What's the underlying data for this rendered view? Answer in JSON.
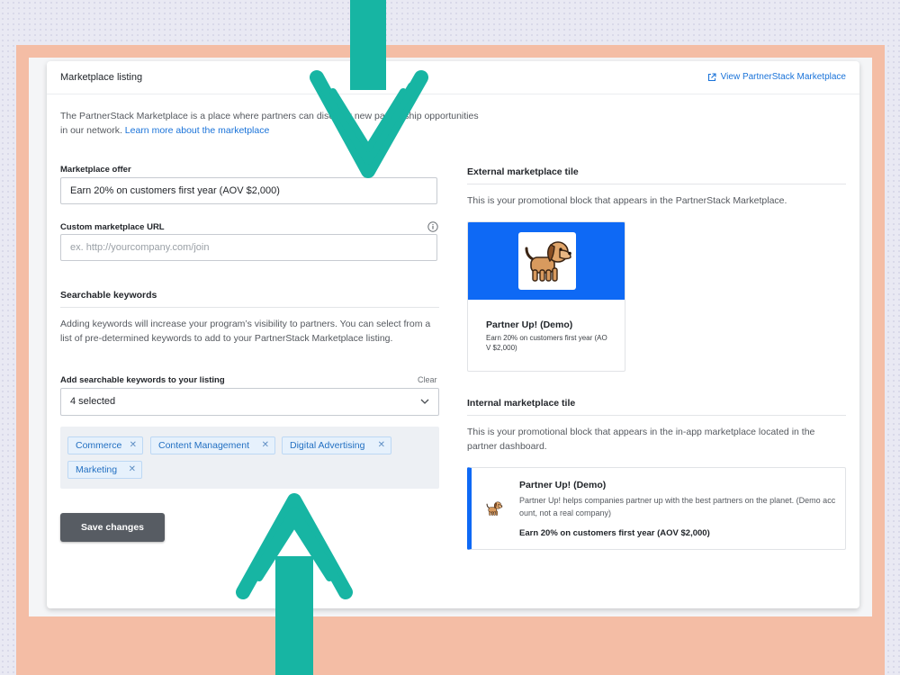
{
  "header": {
    "title": "Marketplace listing",
    "view_link": "View PartnerStack Marketplace"
  },
  "intro": {
    "text_before": "The PartnerStack Marketplace is a place where partners ",
    "text_hidden": "can discover new partnership opportunities",
    "text_line2": "in our network. ",
    "link": "Learn more about the marketplace"
  },
  "form": {
    "offer_label": "Marketplace offer",
    "offer_value": "Earn 20% on customers first year (AOV $2,000)",
    "url_label": "Custom marketplace URL",
    "url_placeholder": "ex. http://yourcompany.com/join"
  },
  "keywords": {
    "heading": "Searchable keywords",
    "description": "Adding keywords will increase your program’s visibility to partners. You can select from a list of pre-determined keywords to add to your PartnerStack Marketplace listing.",
    "add_label": "Add searchable keywords to your listing",
    "clear_label": "Clear",
    "selected_text": "4 selected",
    "chips": [
      "Commerce",
      "Content Management",
      "Digital Advertising",
      "Marketing"
    ]
  },
  "save_button": "Save changes",
  "external_tile": {
    "heading": "External marketplace tile",
    "description": "This is your promotional block that appears in the PartnerStack Marketplace.",
    "name": "Partner Up! (Demo)",
    "offer": "Earn 20% on customers first year (AOV $2,000)"
  },
  "internal_tile": {
    "heading": "Internal marketplace tile",
    "description": "This is your promotional block that appears in the in-app marketplace located in the partner dashboard.",
    "name": "Partner Up! (Demo)",
    "company_description": "Partner Up! helps companies partner up with the best partners on the planet. (Demo account, not a real company)",
    "offer": "Earn 20% on customers first year (AOV $2,000)"
  },
  "colors": {
    "accent_blue": "#0e69f5",
    "link_blue": "#1a73d9",
    "annotation_teal": "#17b5a3",
    "backdrop_peach": "#f4bda5"
  },
  "icons": [
    "external-link-icon",
    "info-icon",
    "chevron-down-icon",
    "close-icon",
    "dog-logo-icon",
    "arrow-down-annotation",
    "arrow-up-annotation"
  ]
}
